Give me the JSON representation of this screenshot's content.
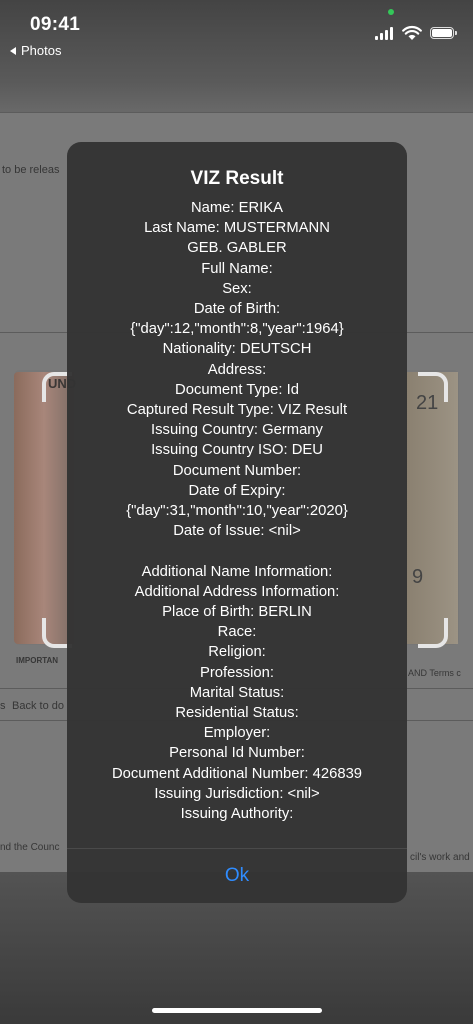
{
  "status_bar": {
    "time": "09:41",
    "back_label": "Photos"
  },
  "background": {
    "text_top": "to be releas",
    "text_important": "IMPORTAN",
    "text_terms": "AND Terms c",
    "text_back": "Back to do",
    "text_council": "nd the Counc",
    "text_work": "cil's work and",
    "text_arrow": "s",
    "card_digits_top": "21",
    "card_digits_bottom": "9",
    "card_letters": "UND"
  },
  "dialog": {
    "title": "VIZ Result",
    "lines": [
      "Name: ERIKA",
      "Last Name: MUSTERMANN",
      "GEB. GABLER",
      "Full Name:",
      "Sex:",
      "Date of Birth:",
      "{\"day\":12,\"month\":8,\"year\":1964}",
      "Nationality: DEUTSCH",
      "Address:",
      "Document Type: Id",
      "Captured Result Type: VIZ Result",
      "Issuing Country: Germany",
      "Issuing Country ISO: DEU",
      "Document Number:",
      "Date of Expiry:",
      "{\"day\":31,\"month\":10,\"year\":2020}",
      "Date of Issue: <nil>",
      "",
      "Additional Name Information:",
      "Additional Address Information:",
      "Place of Birth: BERLIN",
      "Race:",
      "Religion:",
      "Profession:",
      "Marital Status:",
      "Residential Status:",
      "Employer:",
      "Personal Id Number:",
      "Document Additional Number: 426839",
      "Issuing Jurisdiction: <nil>",
      "Issuing Authority:"
    ],
    "ok_label": "Ok",
    "ok_color": "#2f8cff"
  }
}
